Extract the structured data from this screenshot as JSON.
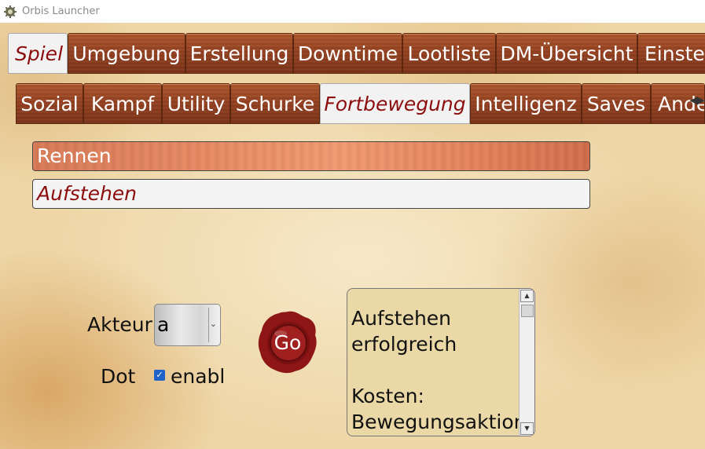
{
  "window": {
    "title": "Orbis Launcher",
    "icon": "gear-icon"
  },
  "main_tabs": [
    "Spiel",
    "Umgebung",
    "Erstellung",
    "Downtime",
    "Lootliste",
    "DM-Übersicht",
    "Einstellungen"
  ],
  "main_tabs_active": "Spiel",
  "sub_tabs": [
    "Sozial",
    "Kampf",
    "Utility",
    "Schurke",
    "Fortbewegung",
    "Intelligenz",
    "Saves",
    "Andere"
  ],
  "sub_tabs_active": "Fortbewegung",
  "actions": [
    {
      "label": "Rennen",
      "state": "selected"
    },
    {
      "label": "Aufstehen",
      "state": "normal"
    }
  ],
  "akteur": {
    "label": "Akteur",
    "value": "a"
  },
  "dot": {
    "label": "Dot",
    "checkbox_label": "enabl",
    "checked": true
  },
  "go_button": {
    "label": "Go"
  },
  "output": {
    "text": "Aufstehen\nerfolgreich\n\nKosten:\nBewegungsaktion"
  },
  "colors": {
    "tab_wood": "#96401f",
    "active_text": "#8b0d0d",
    "selected_item": "#e88a62",
    "output_bg": "#ead9a6",
    "seal": "#8e1616"
  }
}
